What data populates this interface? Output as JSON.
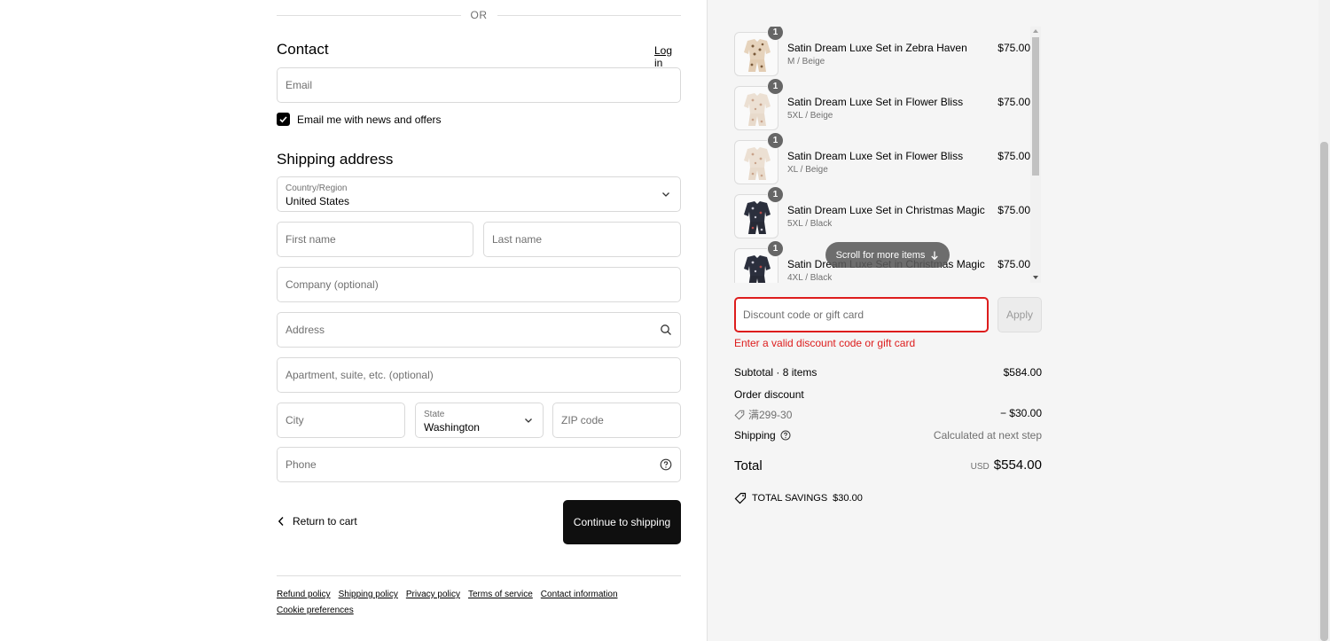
{
  "divider": {
    "or_text": "OR"
  },
  "contact": {
    "heading": "Contact",
    "login_link": "Log in",
    "email_placeholder": "Email",
    "newsletter_label": "Email me with news and offers",
    "newsletter_checked": true
  },
  "shipping": {
    "heading": "Shipping address",
    "country_label": "Country/Region",
    "country_value": "United States",
    "first_name_placeholder": "First name",
    "last_name_placeholder": "Last name",
    "company_placeholder": "Company (optional)",
    "address_placeholder": "Address",
    "apartment_placeholder": "Apartment, suite, etc. (optional)",
    "city_placeholder": "City",
    "state_label": "State",
    "state_value": "Washington",
    "zip_placeholder": "ZIP code",
    "phone_placeholder": "Phone"
  },
  "actions": {
    "return_label": "Return to cart",
    "continue_label": "Continue to shipping"
  },
  "footer": {
    "links": [
      "Refund policy",
      "Shipping policy",
      "Privacy policy",
      "Terms of service",
      "Contact information",
      "Cookie preferences"
    ]
  },
  "order": {
    "items": [
      {
        "qty": "1",
        "name": "Satin Dream Luxe Set in Zebra Haven",
        "variant": "M / Beige",
        "price": "$75.00",
        "pattern": "beige-zebra"
      },
      {
        "qty": "1",
        "name": "Satin Dream Luxe Set in Flower Bliss",
        "variant": "5XL / Beige",
        "price": "$75.00",
        "pattern": "beige-flower"
      },
      {
        "qty": "1",
        "name": "Satin Dream Luxe Set in Flower Bliss",
        "variant": "XL / Beige",
        "price": "$75.00",
        "pattern": "beige-flower"
      },
      {
        "qty": "1",
        "name": "Satin Dream Luxe Set in Christmas Magic",
        "variant": "5XL / Black",
        "price": "$75.00",
        "pattern": "black-christmas"
      },
      {
        "qty": "1",
        "name": "Satin Dream Luxe Set in Christmas Magic",
        "variant": "4XL / Black",
        "price": "$75.00",
        "pattern": "black-christmas"
      }
    ],
    "scroll_hint": "Scroll for more items",
    "discount_placeholder": "Discount code or gift card",
    "apply_label": "Apply",
    "discount_error": "Enter a valid discount code or gift card",
    "subtotal_label": "Subtotal · 8 items",
    "subtotal_value": "$584.00",
    "order_discount_label": "Order discount",
    "discount_code": "满299-30",
    "discount_value": "− $30.00",
    "shipping_label": "Shipping",
    "shipping_value": "Calculated at next step",
    "total_label": "Total",
    "total_currency": "USD",
    "total_value": "$554.00",
    "savings_label": "TOTAL SAVINGS",
    "savings_value": "$30.00"
  },
  "colors": {
    "error": "#dd1d1d",
    "primary_button": "#0f0f0f",
    "summary_background": "#f5f5f5"
  }
}
